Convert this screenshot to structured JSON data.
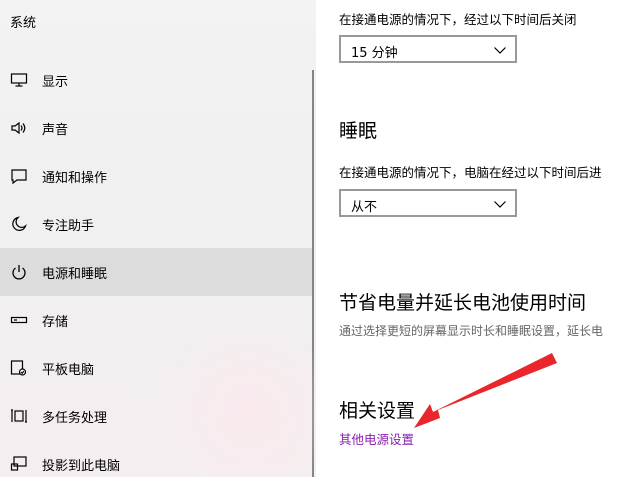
{
  "sidebar": {
    "heading": "系统",
    "items": [
      {
        "label": "显示",
        "icon": "monitor-icon"
      },
      {
        "label": "声音",
        "icon": "speaker-icon"
      },
      {
        "label": "通知和操作",
        "icon": "notification-icon"
      },
      {
        "label": "专注助手",
        "icon": "moon-icon"
      },
      {
        "label": "电源和睡眠",
        "icon": "power-icon",
        "selected": true
      },
      {
        "label": "存储",
        "icon": "storage-icon"
      },
      {
        "label": "平板电脑",
        "icon": "tablet-icon"
      },
      {
        "label": "多任务处理",
        "icon": "multitask-icon"
      },
      {
        "label": "投影到此电脑",
        "icon": "project-icon"
      }
    ]
  },
  "main": {
    "screen": {
      "description": "在接通电源的情况下，经过以下时间后关闭",
      "selected_value": "15 分钟"
    },
    "sleep": {
      "title": "睡眠",
      "description": "在接通电源的情况下，电脑在经过以下时间后进",
      "selected_value": "从不"
    },
    "battery": {
      "title": "节省电量并延长电池使用时间",
      "description": "通过选择更短的屏幕显示时长和睡眠设置，延长电"
    },
    "related": {
      "title": "相关设置",
      "link": "其他电源设置"
    }
  },
  "colors": {
    "link": "#8a1fb0",
    "selected_bg": "#dcdcdc",
    "annotation_arrow": "#e8262b"
  }
}
